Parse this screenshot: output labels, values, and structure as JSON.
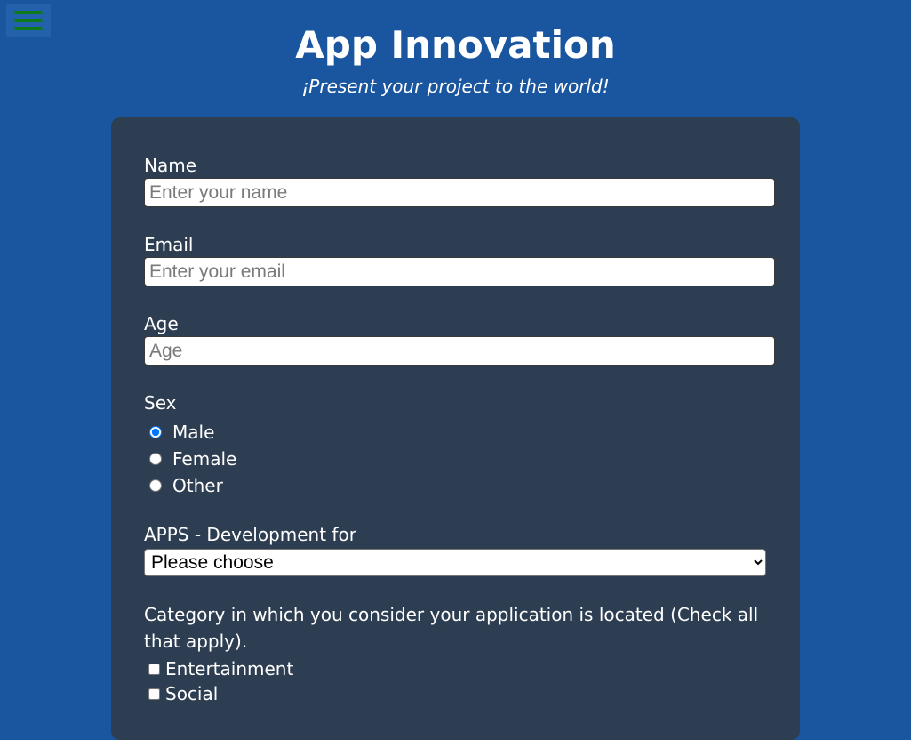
{
  "header": {
    "title": "App Innovation",
    "subtitle": "¡Present your project to the world!"
  },
  "menu": {
    "icon": "hamburger-menu-icon",
    "color": "#0f7a19"
  },
  "form": {
    "name": {
      "label": "Name",
      "placeholder": "Enter your name",
      "value": ""
    },
    "email": {
      "label": "Email",
      "placeholder": "Enter your email",
      "value": ""
    },
    "age": {
      "label": "Age",
      "placeholder": "Age",
      "value": ""
    },
    "sex": {
      "label": "Sex",
      "options": [
        {
          "label": "Male",
          "checked": true
        },
        {
          "label": "Female",
          "checked": false
        },
        {
          "label": "Other",
          "checked": false
        }
      ]
    },
    "apps": {
      "label": "APPS - Development for",
      "selected": "Please choose"
    },
    "category": {
      "label": "Category in which you consider your application is located (Check all that apply).",
      "options": [
        {
          "label": "Entertainment",
          "checked": false
        },
        {
          "label": "Social",
          "checked": false
        }
      ]
    }
  },
  "colors": {
    "background": "#1a56a0",
    "card": "#2e3e52",
    "text": "#ffffff"
  }
}
